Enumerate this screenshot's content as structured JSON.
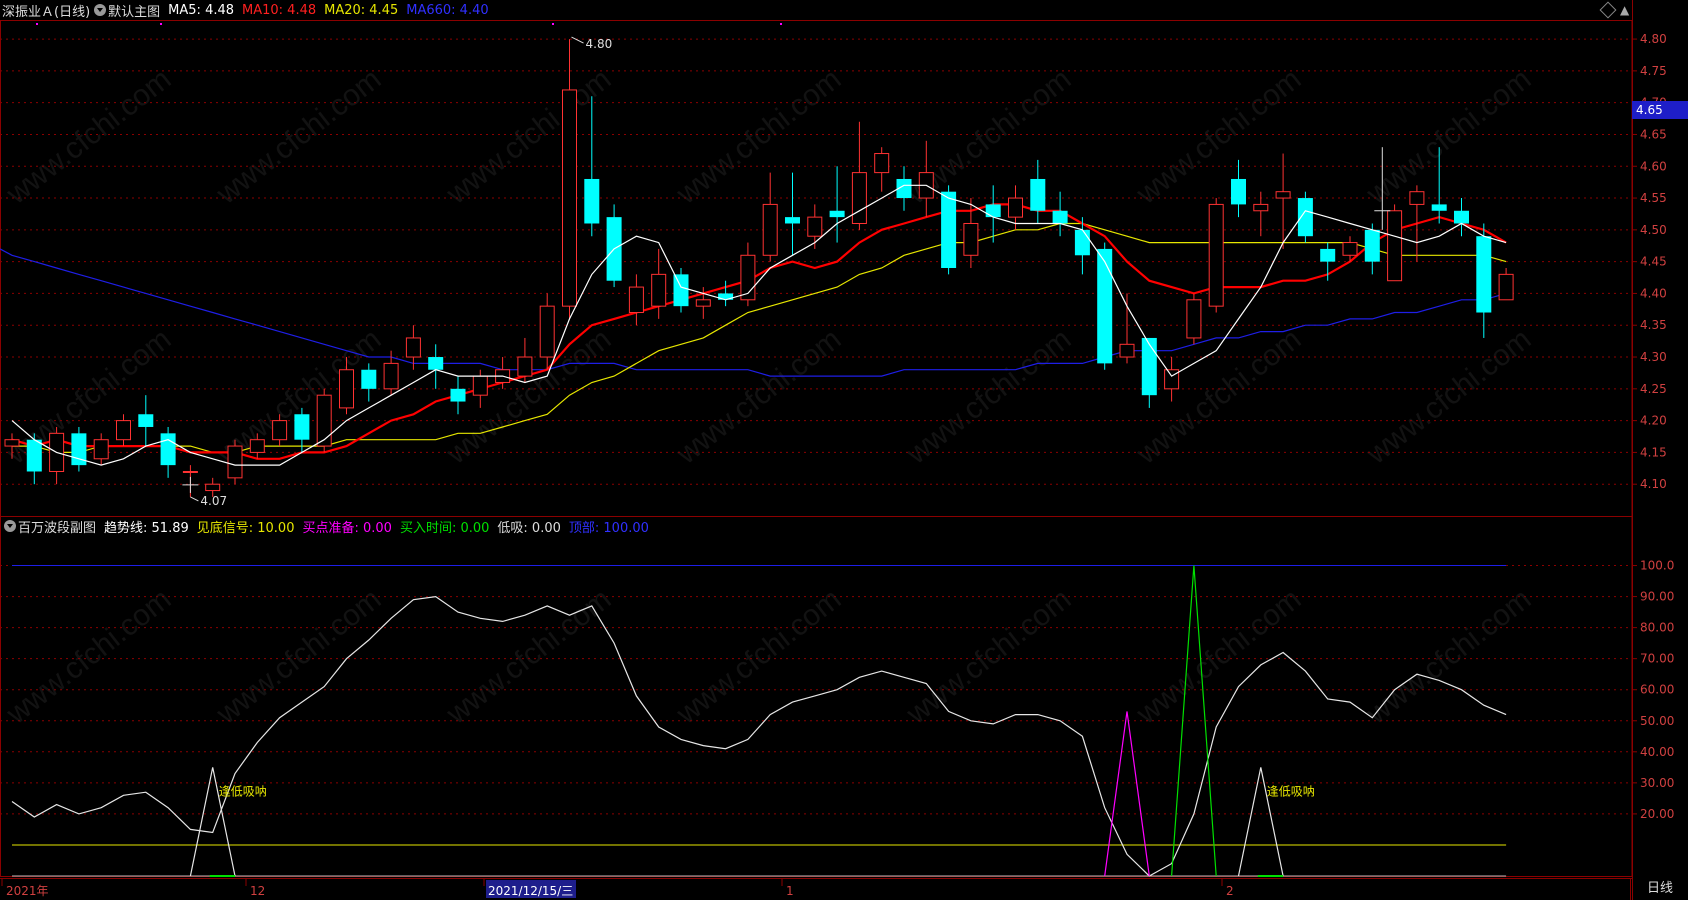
{
  "main": {
    "title": "深振业Ａ(日线)",
    "panel_name": "默认主图",
    "ma5": "MA5: 4.48",
    "ma10": "MA10: 4.48",
    "ma20": "MA20: 4.45",
    "ma660": "MA660: 4.40",
    "current_price": "4.65",
    "high_label": "4.80",
    "low_label": "4.07",
    "price_axis": [
      "4.80",
      "4.75",
      "4.70",
      "4.65",
      "4.60",
      "4.55",
      "4.50",
      "4.45",
      "4.40",
      "4.35",
      "4.30",
      "4.25",
      "4.20",
      "4.15",
      "4.10"
    ]
  },
  "sub": {
    "panel_name": "百万波段副图",
    "trend": "趋势线: 51.89",
    "bottom_signal": "见底信号: 10.00",
    "buy_prep": "买点准备: 0.00",
    "buy_time": "买入时间: 0.00",
    "low_suck": "低吸: 0.00",
    "top": "顶部: 100.00",
    "axis": [
      "100.0",
      "90.00",
      "80.00",
      "70.00",
      "60.00",
      "50.00",
      "40.00",
      "30.00",
      "20.00"
    ],
    "annotation_1": "逢低吸呐",
    "annotation_2": "逢低吸呐"
  },
  "date_axis": {
    "labels": [
      "2021年",
      "12",
      "2021/12/15/三",
      "1",
      "2"
    ],
    "period": "日线"
  },
  "watermark": "www.cfchi.com",
  "colors": {
    "up": "#ff3232",
    "down": "#00ffff",
    "ma5": "#ffffff",
    "ma10": "#ff0000",
    "ma20": "#e6e600",
    "ma660": "#1e1ee6",
    "grid": "#8b0000",
    "magenta": "#ff00ff",
    "green": "#00e000"
  },
  "chart_data": [
    {
      "type": "candlestick",
      "title": "深振业Ａ(日线)",
      "ylim": [
        4.05,
        4.82
      ],
      "candles": [
        [
          4.16,
          4.17,
          4.14,
          4.18
        ],
        [
          4.17,
          4.12,
          4.1,
          4.18
        ],
        [
          4.12,
          4.18,
          4.1,
          4.19
        ],
        [
          4.18,
          4.13,
          4.12,
          4.19
        ],
        [
          4.14,
          4.17,
          4.13,
          4.18
        ],
        [
          4.17,
          4.2,
          4.16,
          4.21
        ],
        [
          4.21,
          4.19,
          4.16,
          4.24
        ],
        [
          4.18,
          4.13,
          4.11,
          4.19
        ],
        [
          4.12,
          4.12,
          4.08,
          4.13
        ],
        [
          4.09,
          4.1,
          4.08,
          4.11
        ],
        [
          4.11,
          4.16,
          4.1,
          4.17
        ],
        [
          4.15,
          4.17,
          4.14,
          4.18
        ],
        [
          4.17,
          4.2,
          4.16,
          4.21
        ],
        [
          4.21,
          4.17,
          4.15,
          4.22
        ],
        [
          4.16,
          4.24,
          4.15,
          4.25
        ],
        [
          4.22,
          4.28,
          4.21,
          4.3
        ],
        [
          4.28,
          4.25,
          4.23,
          4.29
        ],
        [
          4.25,
          4.29,
          4.24,
          4.31
        ],
        [
          4.3,
          4.33,
          4.28,
          4.35
        ],
        [
          4.3,
          4.28,
          4.25,
          4.32
        ],
        [
          4.25,
          4.23,
          4.21,
          4.27
        ],
        [
          4.24,
          4.27,
          4.22,
          4.28
        ],
        [
          4.26,
          4.28,
          4.25,
          4.3
        ],
        [
          4.27,
          4.3,
          4.26,
          4.33
        ],
        [
          4.3,
          4.38,
          4.28,
          4.4
        ],
        [
          4.38,
          4.72,
          4.36,
          4.8
        ],
        [
          4.58,
          4.51,
          4.49,
          4.71
        ],
        [
          4.52,
          4.42,
          4.41,
          4.54
        ],
        [
          4.37,
          4.41,
          4.35,
          4.43
        ],
        [
          4.38,
          4.43,
          4.36,
          4.47
        ],
        [
          4.43,
          4.38,
          4.37,
          4.44
        ],
        [
          4.38,
          4.39,
          4.36,
          4.41
        ],
        [
          4.4,
          4.39,
          4.38,
          4.42
        ],
        [
          4.39,
          4.46,
          4.38,
          4.48
        ],
        [
          4.46,
          4.54,
          4.45,
          4.59
        ],
        [
          4.52,
          4.51,
          4.46,
          4.59
        ],
        [
          4.49,
          4.52,
          4.47,
          4.54
        ],
        [
          4.53,
          4.52,
          4.48,
          4.6
        ],
        [
          4.51,
          4.59,
          4.5,
          4.67
        ],
        [
          4.59,
          4.62,
          4.56,
          4.63
        ],
        [
          4.58,
          4.55,
          4.53,
          4.6
        ],
        [
          4.55,
          4.59,
          4.52,
          4.64
        ],
        [
          4.56,
          4.44,
          4.43,
          4.57
        ],
        [
          4.46,
          4.51,
          4.44,
          4.55
        ],
        [
          4.54,
          4.52,
          4.48,
          4.57
        ],
        [
          4.52,
          4.55,
          4.5,
          4.57
        ],
        [
          4.58,
          4.53,
          4.51,
          4.61
        ],
        [
          4.53,
          4.51,
          4.49,
          4.56
        ],
        [
          4.5,
          4.46,
          4.43,
          4.52
        ],
        [
          4.47,
          4.29,
          4.28,
          4.48
        ],
        [
          4.3,
          4.32,
          4.29,
          4.4
        ],
        [
          4.33,
          4.24,
          4.22,
          4.33
        ],
        [
          4.25,
          4.28,
          4.23,
          4.3
        ],
        [
          4.33,
          4.39,
          4.32,
          4.4
        ],
        [
          4.38,
          4.54,
          4.37,
          4.55
        ],
        [
          4.58,
          4.54,
          4.52,
          4.61
        ],
        [
          4.53,
          4.54,
          4.49,
          4.56
        ],
        [
          4.55,
          4.56,
          4.47,
          4.62
        ],
        [
          4.55,
          4.49,
          4.48,
          4.56
        ],
        [
          4.47,
          4.45,
          4.42,
          4.48
        ],
        [
          4.46,
          4.48,
          4.45,
          4.49
        ],
        [
          4.5,
          4.45,
          4.43,
          4.51
        ],
        [
          4.42,
          4.53,
          4.42,
          4.54
        ],
        [
          4.54,
          4.56,
          4.45,
          4.57
        ],
        [
          4.54,
          4.53,
          4.51,
          4.63
        ],
        [
          4.53,
          4.51,
          4.49,
          4.55
        ],
        [
          4.49,
          4.37,
          4.33,
          4.51
        ],
        [
          4.39,
          4.43,
          4.39,
          4.44
        ]
      ],
      "ma5": [
        4.2,
        4.17,
        4.15,
        4.14,
        4.13,
        4.14,
        4.16,
        4.17,
        4.15,
        4.14,
        4.13,
        4.13,
        4.13,
        4.15,
        4.17,
        4.2,
        4.22,
        4.24,
        4.26,
        4.28,
        4.27,
        4.27,
        4.27,
        4.26,
        4.27,
        4.36,
        4.43,
        4.47,
        4.49,
        4.48,
        4.41,
        4.4,
        4.39,
        4.4,
        4.44,
        4.46,
        4.48,
        4.51,
        4.53,
        4.55,
        4.57,
        4.57,
        4.55,
        4.54,
        4.52,
        4.51,
        4.51,
        4.51,
        4.5,
        4.45,
        4.38,
        4.32,
        4.27,
        4.29,
        4.31,
        4.36,
        4.41,
        4.48,
        4.53,
        4.52,
        4.51,
        4.5,
        4.49,
        4.48,
        4.49,
        4.51,
        4.49,
        4.48
      ],
      "ma10": [
        4.17,
        4.16,
        4.17,
        4.16,
        4.16,
        4.16,
        4.16,
        4.16,
        4.15,
        4.15,
        4.15,
        4.14,
        4.14,
        4.15,
        4.15,
        4.16,
        4.18,
        4.2,
        4.21,
        4.23,
        4.24,
        4.25,
        4.26,
        4.27,
        4.28,
        4.32,
        4.35,
        4.36,
        4.37,
        4.38,
        4.39,
        4.4,
        4.41,
        4.42,
        4.44,
        4.45,
        4.44,
        4.45,
        4.48,
        4.5,
        4.51,
        4.52,
        4.53,
        4.53,
        4.54,
        4.54,
        4.53,
        4.53,
        4.51,
        4.49,
        4.45,
        4.42,
        4.41,
        4.4,
        4.41,
        4.41,
        4.41,
        4.42,
        4.42,
        4.43,
        4.45,
        4.48,
        4.5,
        4.51,
        4.52,
        4.51,
        4.5,
        4.48
      ],
      "ma20": [
        4.16,
        4.16,
        4.15,
        4.15,
        4.16,
        4.16,
        4.16,
        4.16,
        4.16,
        4.15,
        4.15,
        4.16,
        4.16,
        4.16,
        4.16,
        4.17,
        4.17,
        4.17,
        4.17,
        4.17,
        4.18,
        4.18,
        4.19,
        4.2,
        4.21,
        4.24,
        4.26,
        4.27,
        4.29,
        4.31,
        4.32,
        4.33,
        4.35,
        4.37,
        4.38,
        4.39,
        4.4,
        4.41,
        4.43,
        4.44,
        4.46,
        4.47,
        4.48,
        4.48,
        4.49,
        4.5,
        4.5,
        4.51,
        4.51,
        4.5,
        4.49,
        4.48,
        4.48,
        4.48,
        4.48,
        4.48,
        4.48,
        4.48,
        4.48,
        4.48,
        4.48,
        4.47,
        4.46,
        4.46,
        4.46,
        4.46,
        4.46,
        4.45
      ],
      "ma660": [
        4.46,
        4.45,
        4.44,
        4.43,
        4.42,
        4.41,
        4.4,
        4.39,
        4.38,
        4.37,
        4.36,
        4.35,
        4.34,
        4.33,
        4.32,
        4.31,
        4.3,
        4.3,
        4.29,
        4.29,
        4.29,
        4.29,
        4.28,
        4.28,
        4.28,
        4.29,
        4.29,
        4.29,
        4.28,
        4.28,
        4.28,
        4.28,
        4.28,
        4.28,
        4.27,
        4.27,
        4.27,
        4.27,
        4.27,
        4.27,
        4.28,
        4.28,
        4.28,
        4.28,
        4.28,
        4.28,
        4.29,
        4.29,
        4.29,
        4.3,
        4.31,
        4.31,
        4.31,
        4.32,
        4.33,
        4.33,
        4.34,
        4.34,
        4.35,
        4.35,
        4.36,
        4.36,
        4.37,
        4.37,
        4.38,
        4.39,
        4.39,
        4.4
      ]
    },
    {
      "type": "line",
      "title": "百万波段副图",
      "ylim": [
        0,
        105
      ],
      "trend": [
        24,
        19,
        23,
        20,
        22,
        26,
        27,
        22,
        15,
        14,
        33,
        43,
        51,
        56,
        61,
        70,
        76,
        83,
        89,
        90,
        85,
        83,
        82,
        84,
        87,
        84,
        87,
        75,
        58,
        48,
        44,
        42,
        41,
        44,
        52,
        56,
        58,
        60,
        64,
        66,
        64,
        62,
        53,
        50,
        49,
        52,
        52,
        50,
        45,
        22,
        7,
        0,
        4,
        20,
        48,
        61,
        68,
        72,
        66,
        57,
        56,
        51,
        60,
        65,
        63,
        60,
        55,
        52
      ],
      "bottom_signal_level": 10,
      "top_level": 100,
      "low_suck_spikes": [
        [
          9,
          35
        ],
        [
          56,
          35
        ]
      ],
      "buy_prep_range": [
        50,
        53,
        50
      ],
      "buy_time_spike": [
        53,
        100
      ]
    }
  ]
}
